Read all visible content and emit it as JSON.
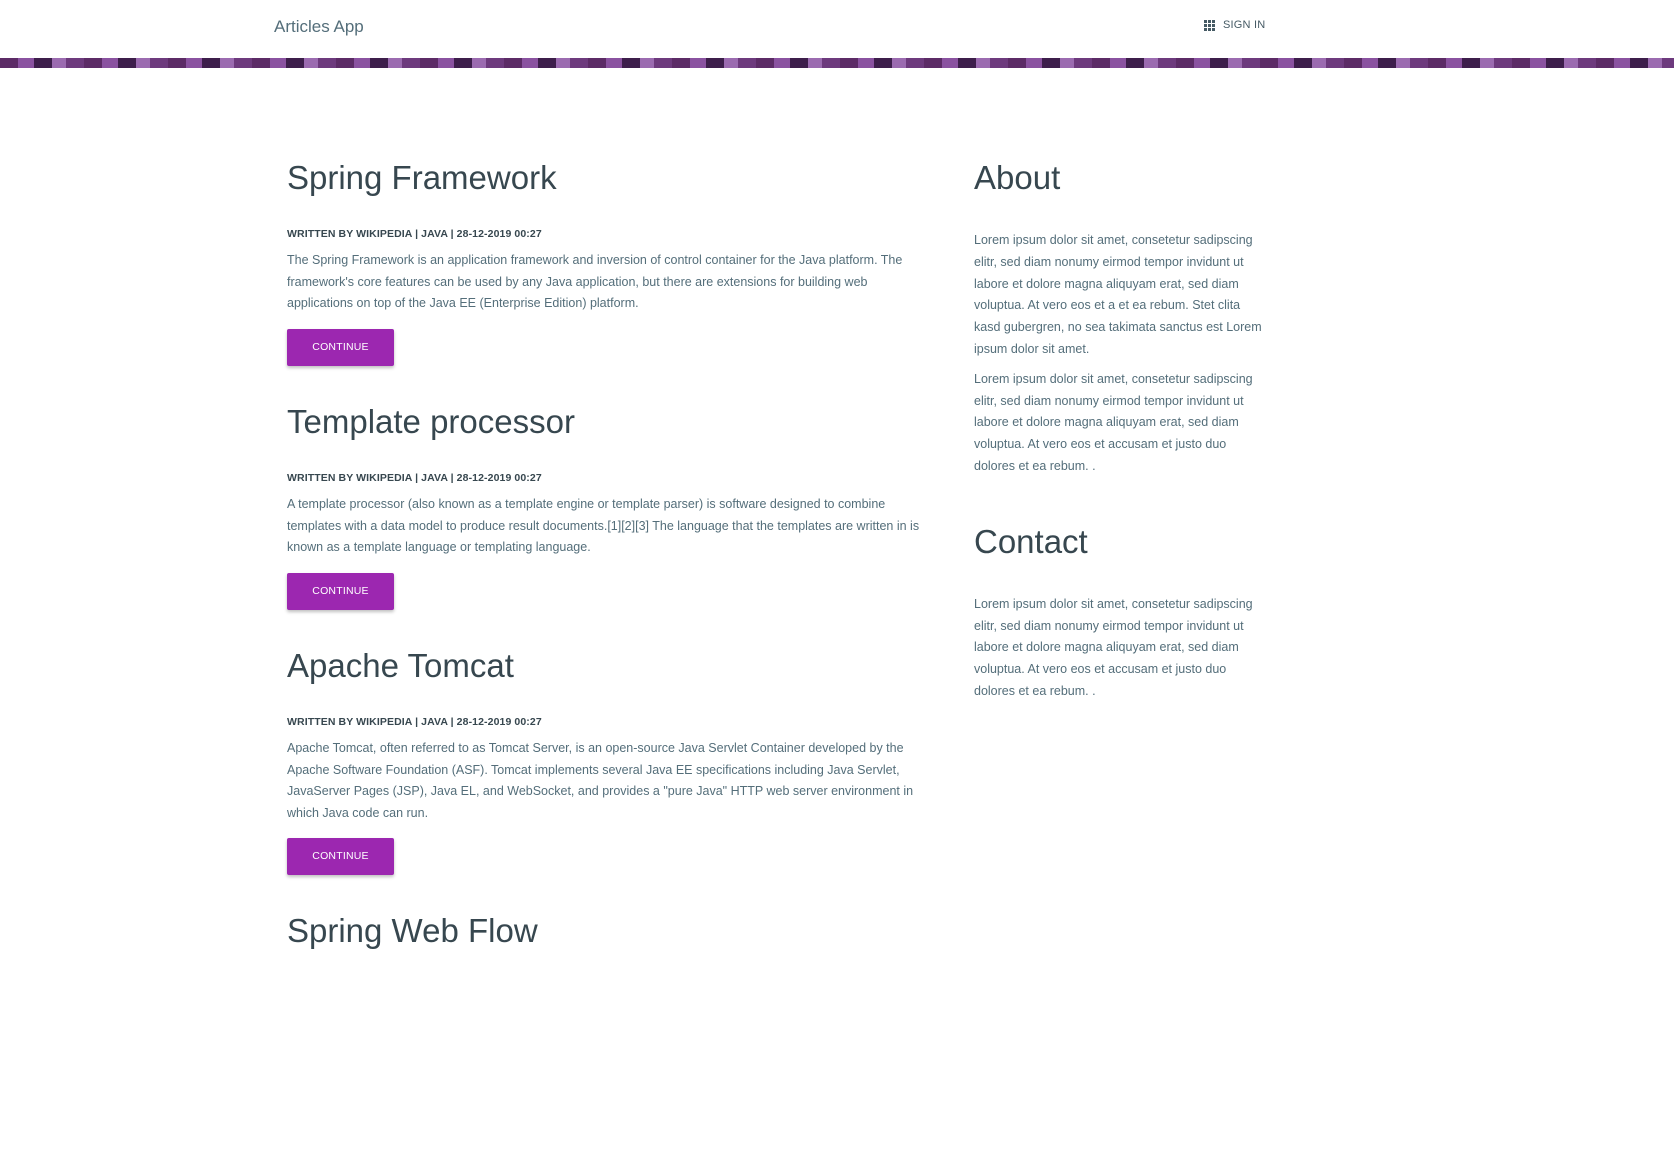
{
  "header": {
    "brand": "Articles App",
    "signin_icon": "grid-icon",
    "signin_label": "SIGN IN"
  },
  "articles": [
    {
      "title": "Spring Framework",
      "meta": "WRITTEN BY WIKIPEDIA | JAVA | 28-12-2019 00:27",
      "excerpt": "The Spring Framework is an application framework and inversion of control container for the Java platform. The framework's core features can be used by any Java application, but there are extensions for building web applications on top of the Java EE (Enterprise Edition) platform.",
      "button": "CONTINUE"
    },
    {
      "title": "Template processor",
      "meta": "WRITTEN BY WIKIPEDIA | JAVA | 28-12-2019 00:27",
      "excerpt": "A template processor (also known as a template engine or template parser) is software designed to combine templates with a data model to produce result documents.[1][2][3] The language that the templates are written in is known as a template language or templating language.",
      "button": "CONTINUE"
    },
    {
      "title": "Apache Tomcat",
      "meta": "WRITTEN BY WIKIPEDIA | JAVA | 28-12-2019 00:27",
      "excerpt": "Apache Tomcat, often referred to as Tomcat Server, is an open-source Java Servlet Container developed by the Apache Software Foundation (ASF). Tomcat implements several Java EE specifications including Java Servlet, JavaServer Pages (JSP), Java EL, and WebSocket, and provides a \"pure Java\" HTTP web server environment in which Java code can run.",
      "button": "CONTINUE"
    },
    {
      "title": "Spring Web Flow"
    }
  ],
  "sidebar": {
    "about_title": "About",
    "about_p1": "Lorem ipsum dolor sit amet, consetetur sadipscing elitr, sed diam nonumy eirmod tempor invidunt ut labore et dolore magna aliquyam erat, sed diam voluptua. At vero eos et a et ea rebum. Stet clita kasd gubergren, no sea takimata sanctus est Lorem ipsum dolor sit amet.",
    "about_p2": "Lorem ipsum dolor sit amet, consetetur sadipscing elitr, sed diam nonumy eirmod tempor invidunt ut labore et dolore magna aliquyam erat, sed diam voluptua. At vero eos et accusam et justo duo dolores et ea rebum. .",
    "contact_title": "Contact",
    "contact_p1": "Lorem ipsum dolor sit amet, consetetur sadipscing elitr, sed diam nonumy eirmod tempor invidunt ut labore et dolore magna aliquyam erat, sed diam voluptua. At vero eos et accusam et justo duo dolores et ea rebum. ."
  },
  "colors": {
    "accent": "#9c27b0",
    "text": "#37474f",
    "muted": "#546e7a"
  }
}
